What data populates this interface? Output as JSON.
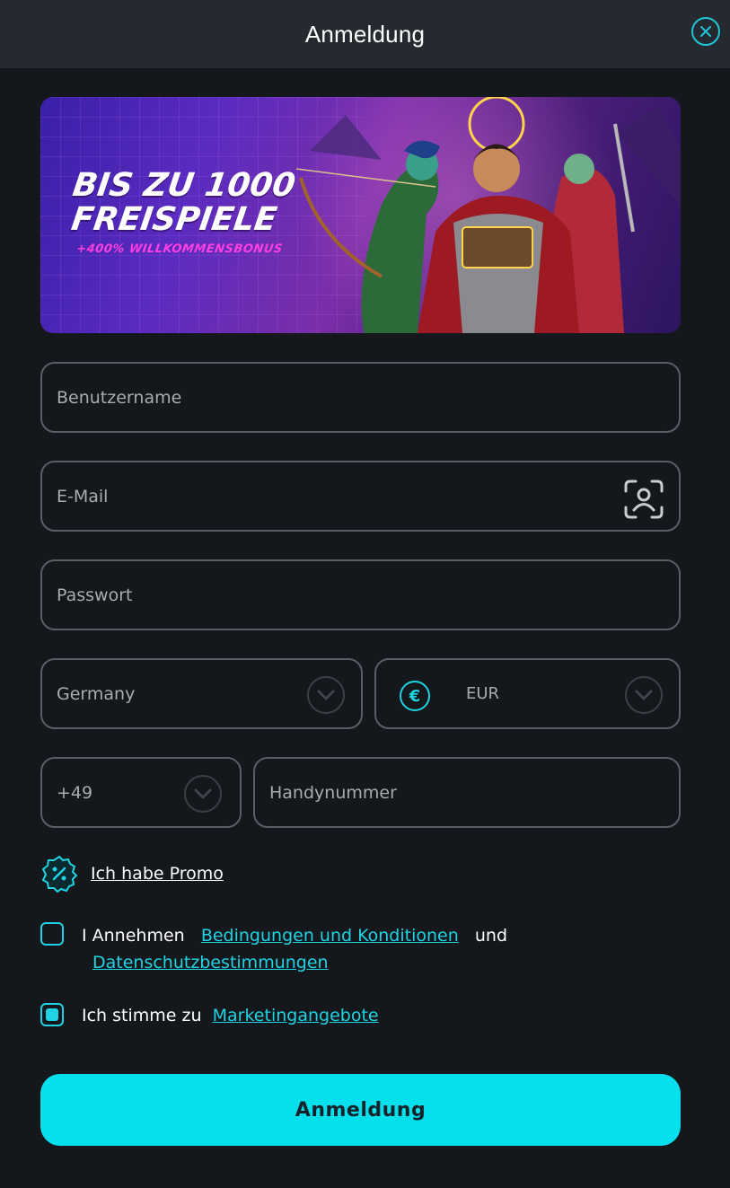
{
  "header": {
    "title": "Anmeldung",
    "close_icon": "close-icon"
  },
  "banner": {
    "line1": "BIS ZU 1000",
    "line2": "FREISPIELE",
    "sub": "+400% WILLKOMMENSBONUS"
  },
  "form": {
    "username_placeholder": "Benutzername",
    "email_placeholder": "E-Mail",
    "password_placeholder": "Passwort",
    "country_value": "Germany",
    "currency_value": "EUR",
    "currency_symbol": "€",
    "phone_code_value": "+49",
    "phone_placeholder": "Handynummer"
  },
  "promo": {
    "label": "Ich habe Promo"
  },
  "terms": {
    "prefix": "I Annehmen",
    "link1": "Bedingungen und Konditionen",
    "middle": "und",
    "link2": "Datenschutzbestimmungen",
    "checked": false
  },
  "marketing": {
    "prefix": "Ich stimme zu",
    "link": "Marketingangebote",
    "checked": true
  },
  "submit_label": "Anmeldung",
  "colors": {
    "accent": "#06e0ec",
    "background": "#14171b",
    "header": "#242a2f",
    "promo_pink": "#ff3fe0"
  }
}
